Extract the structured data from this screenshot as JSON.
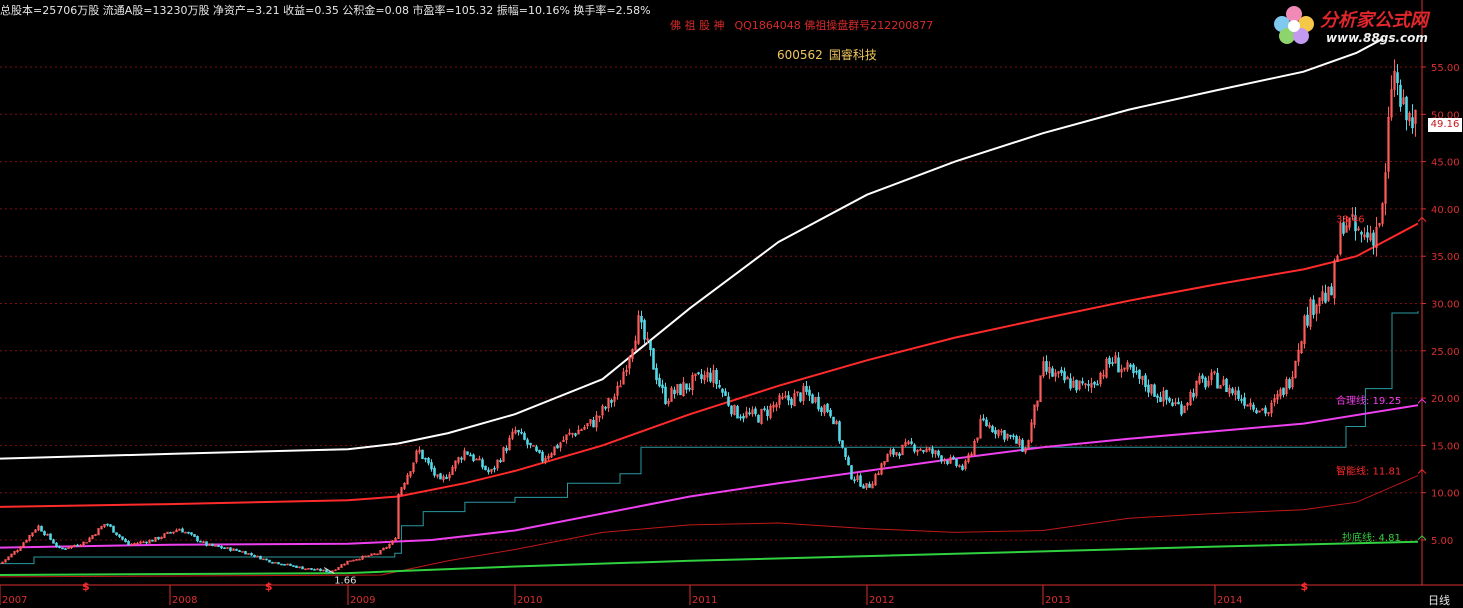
{
  "header": {
    "stock_info": "总股本=25706万股 流通A股=13230万股 净资产=3.21 收益=0.35 公积金=0.08  市盈率=105.32 振幅=10.16% 换手率=2.58%",
    "banner_brand": "佛 祖 股 神",
    "banner_qq": "QQ1864048 佛祖操盘群号212200877",
    "stock_code": "600562",
    "stock_name": "国睿科技"
  },
  "logo": {
    "text": "分析家公式网",
    "url": "www.88gs.com",
    "icon": "flower-logo-icon"
  },
  "period_label": "日线",
  "current_price_box": "49.16",
  "colors": {
    "background": "#000000",
    "candle_up": "#ff5b5b",
    "candle_down": "#54d8e6",
    "top_line": "#ffffff",
    "red_line": "#ff2a2a",
    "magenta_line": "#ee40ee",
    "green_line": "#30d040",
    "teal_step": "#2a9aa0",
    "thin_red": "#c01818",
    "grid": "#7a1010",
    "axis_text": "#d83030"
  },
  "chart_data": {
    "type": "candlestick",
    "ylim": [
      0,
      58
    ],
    "y_ticks": [
      "5.00",
      "10.00",
      "15.00",
      "20.00",
      "25.00",
      "30.00",
      "35.00",
      "40.00",
      "45.00",
      "50.00",
      "55.00"
    ],
    "x_ticks": [
      "2007",
      "2008",
      "2009",
      "2010",
      "2011",
      "2012",
      "2013",
      "2014"
    ],
    "low_annotation": "1.66",
    "markers": [
      "$",
      "$",
      "$"
    ],
    "line_labels": [
      {
        "label": "合理线:",
        "value": "19.25"
      },
      {
        "label": "智能线:",
        "value": "11.81"
      },
      {
        "label": "抄底线:",
        "value": "4.81"
      },
      {
        "label": "",
        "value": "38.46"
      }
    ],
    "price_path": [
      {
        "t": 2007.0,
        "p": 2.5
      },
      {
        "t": 2007.1,
        "p": 4.0
      },
      {
        "t": 2007.22,
        "p": 6.5
      },
      {
        "t": 2007.35,
        "p": 4.0
      },
      {
        "t": 2007.5,
        "p": 4.8
      },
      {
        "t": 2007.62,
        "p": 6.8
      },
      {
        "t": 2007.75,
        "p": 4.5
      },
      {
        "t": 2007.9,
        "p": 5.0
      },
      {
        "t": 2008.05,
        "p": 6.2
      },
      {
        "t": 2008.2,
        "p": 4.5
      },
      {
        "t": 2008.4,
        "p": 3.8
      },
      {
        "t": 2008.55,
        "p": 2.8
      },
      {
        "t": 2008.75,
        "p": 2.0
      },
      {
        "t": 2008.9,
        "p": 1.66
      },
      {
        "t": 2009.0,
        "p": 2.8
      },
      {
        "t": 2009.18,
        "p": 3.6
      },
      {
        "t": 2009.28,
        "p": 5.0
      },
      {
        "t": 2009.3,
        "p": 10.0
      },
      {
        "t": 2009.42,
        "p": 14.5
      },
      {
        "t": 2009.55,
        "p": 11.0
      },
      {
        "t": 2009.7,
        "p": 14.5
      },
      {
        "t": 2009.85,
        "p": 12.0
      },
      {
        "t": 2010.0,
        "p": 16.5
      },
      {
        "t": 2010.15,
        "p": 13.5
      },
      {
        "t": 2010.3,
        "p": 16.0
      },
      {
        "t": 2010.45,
        "p": 17.5
      },
      {
        "t": 2010.58,
        "p": 20.5
      },
      {
        "t": 2010.7,
        "p": 28.0
      },
      {
        "t": 2010.78,
        "p": 24.0
      },
      {
        "t": 2010.85,
        "p": 20.0
      },
      {
        "t": 2011.0,
        "p": 21.5
      },
      {
        "t": 2011.12,
        "p": 22.5
      },
      {
        "t": 2011.25,
        "p": 18.5
      },
      {
        "t": 2011.38,
        "p": 18.0
      },
      {
        "t": 2011.5,
        "p": 19.5
      },
      {
        "t": 2011.65,
        "p": 20.5
      },
      {
        "t": 2011.8,
        "p": 18.5
      },
      {
        "t": 2011.9,
        "p": 12.0
      },
      {
        "t": 2012.0,
        "p": 10.5
      },
      {
        "t": 2012.12,
        "p": 14.0
      },
      {
        "t": 2012.25,
        "p": 15.0
      },
      {
        "t": 2012.4,
        "p": 14.0
      },
      {
        "t": 2012.55,
        "p": 12.5
      },
      {
        "t": 2012.65,
        "p": 17.5
      },
      {
        "t": 2012.8,
        "p": 16.0
      },
      {
        "t": 2012.9,
        "p": 14.5
      },
      {
        "t": 2013.0,
        "p": 23.0
      },
      {
        "t": 2013.1,
        "p": 22.0
      },
      {
        "t": 2013.25,
        "p": 21.0
      },
      {
        "t": 2013.4,
        "p": 24.0
      },
      {
        "t": 2013.55,
        "p": 22.0
      },
      {
        "t": 2013.7,
        "p": 20.0
      },
      {
        "t": 2013.8,
        "p": 19.0
      },
      {
        "t": 2013.9,
        "p": 21.5
      },
      {
        "t": 2014.0,
        "p": 22.0
      },
      {
        "t": 2014.15,
        "p": 20.0
      },
      {
        "t": 2014.3,
        "p": 18.5
      },
      {
        "t": 2014.42,
        "p": 22.0
      },
      {
        "t": 2014.5,
        "p": 28.0
      },
      {
        "t": 2014.58,
        "p": 31.0
      },
      {
        "t": 2014.65,
        "p": 30.5
      },
      {
        "t": 2014.72,
        "p": 39.0
      },
      {
        "t": 2014.82,
        "p": 37.0
      },
      {
        "t": 2014.9,
        "p": 37.5
      },
      {
        "t": 2014.95,
        "p": 40.0
      },
      {
        "t": 2015.0,
        "p": 55.0
      },
      {
        "t": 2015.08,
        "p": 50.0
      },
      {
        "t": 2015.15,
        "p": 49.16
      }
    ],
    "white_line": [
      [
        2007.0,
        13.6
      ],
      [
        2008.0,
        14.1
      ],
      [
        2009.0,
        14.6
      ],
      [
        2009.3,
        15.2
      ],
      [
        2009.6,
        16.3
      ],
      [
        2010.0,
        18.3
      ],
      [
        2010.5,
        22.0
      ],
      [
        2011.0,
        29.5
      ],
      [
        2011.5,
        36.5
      ],
      [
        2012.0,
        41.5
      ],
      [
        2012.5,
        45.0
      ],
      [
        2013.0,
        48.0
      ],
      [
        2013.5,
        50.5
      ],
      [
        2014.0,
        52.5
      ],
      [
        2014.5,
        54.5
      ],
      [
        2014.8,
        56.5
      ],
      [
        2014.95,
        58.0
      ]
    ],
    "red_line": [
      [
        2007.0,
        8.5
      ],
      [
        2008.0,
        8.8
      ],
      [
        2009.0,
        9.2
      ],
      [
        2009.3,
        9.6
      ],
      [
        2009.7,
        11.0
      ],
      [
        2010.0,
        12.3
      ],
      [
        2010.5,
        15.0
      ],
      [
        2011.0,
        18.3
      ],
      [
        2011.5,
        21.3
      ],
      [
        2012.0,
        24.0
      ],
      [
        2012.5,
        26.4
      ],
      [
        2013.0,
        28.4
      ],
      [
        2013.5,
        30.3
      ],
      [
        2014.0,
        32.0
      ],
      [
        2014.5,
        33.6
      ],
      [
        2014.8,
        35.0
      ],
      [
        2015.2,
        38.46
      ]
    ],
    "magenta_line": [
      [
        2007.0,
        4.2
      ],
      [
        2008.0,
        4.5
      ],
      [
        2009.0,
        4.6
      ],
      [
        2009.5,
        5.0
      ],
      [
        2010.0,
        6.0
      ],
      [
        2010.5,
        7.8
      ],
      [
        2011.0,
        9.6
      ],
      [
        2011.5,
        11.0
      ],
      [
        2012.0,
        12.3
      ],
      [
        2012.5,
        13.6
      ],
      [
        2013.0,
        14.8
      ],
      [
        2013.5,
        15.7
      ],
      [
        2014.0,
        16.5
      ],
      [
        2014.5,
        17.3
      ],
      [
        2015.2,
        19.25
      ]
    ],
    "green_line": [
      [
        2007.0,
        1.3
      ],
      [
        2009.0,
        1.5
      ],
      [
        2010.0,
        2.2
      ],
      [
        2011.0,
        2.8
      ],
      [
        2012.0,
        3.3
      ],
      [
        2013.0,
        3.8
      ],
      [
        2014.0,
        4.3
      ],
      [
        2015.2,
        4.81
      ]
    ],
    "teal_step": [
      [
        2007.0,
        2.5
      ],
      [
        2007.2,
        3.2
      ],
      [
        2009.28,
        3.6
      ],
      [
        2009.32,
        6.5
      ],
      [
        2009.45,
        8.0
      ],
      [
        2009.7,
        9.0
      ],
      [
        2010.0,
        9.5
      ],
      [
        2010.3,
        11.0
      ],
      [
        2010.6,
        12.0
      ],
      [
        2010.72,
        14.8
      ],
      [
        2014.7,
        14.8
      ],
      [
        2014.74,
        17.0
      ],
      [
        2014.85,
        21.0
      ],
      [
        2015.0,
        29.0
      ],
      [
        2015.2,
        29.2
      ]
    ],
    "thin_red": [
      [
        2007.0,
        1.1
      ],
      [
        2009.2,
        1.3
      ],
      [
        2009.6,
        2.8
      ],
      [
        2010.0,
        4.0
      ],
      [
        2010.5,
        5.8
      ],
      [
        2011.0,
        6.6
      ],
      [
        2011.5,
        6.8
      ],
      [
        2012.0,
        6.2
      ],
      [
        2012.5,
        5.8
      ],
      [
        2013.0,
        6.0
      ],
      [
        2013.5,
        7.3
      ],
      [
        2014.0,
        7.8
      ],
      [
        2014.5,
        8.2
      ],
      [
        2014.8,
        9.0
      ],
      [
        2015.2,
        11.81
      ]
    ]
  }
}
